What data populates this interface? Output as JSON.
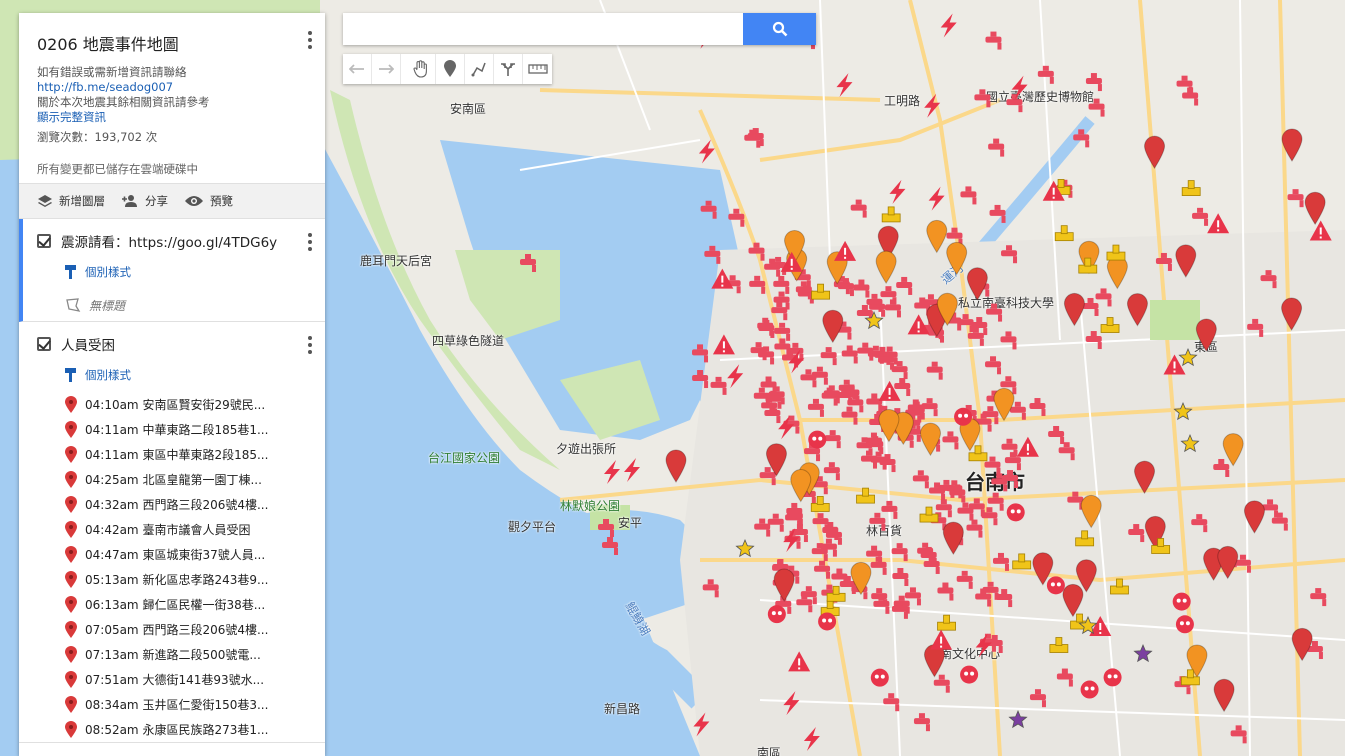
{
  "app": {
    "map_title": "0206 地震事件地圖",
    "desc_prefix": "如有錯誤或需新增資訊請聯絡",
    "desc_link": "http://fb.me/seadog007",
    "desc_line2": "關於本次地震其餘相關資訊請參考",
    "show_full": "顯示完整資訊",
    "views": "瀏覽次數：193,702 次",
    "saved": "所有變更都已儲存在雲端硬碟中"
  },
  "toolbar": {
    "add_layer": "新增圖層",
    "share": "分享",
    "preview": "預覽"
  },
  "layers": [
    {
      "title": "震源請看：https://goo.gl/4TDG6y",
      "style_label": "個別樣式",
      "untitled": "無標題"
    },
    {
      "title": "人員受困",
      "style_label": "個別樣式",
      "items": [
        "04:10am 安南區賢安街29號民...",
        "04:11am 中華東路二段185巷1...",
        "04:11am 東區中華東路2段185...",
        "04:25am 北區皇龍第一園丁棟...",
        "04:32am 西門路三段206號4樓...",
        "04:42am 臺南市議會人員受困",
        "04:47am 東區城東街37號人員...",
        "05:13am 新化區忠孝路243巷9...",
        "06:13am 歸仁區民權一街38巷...",
        "07:05am 西門路三段206號4樓...",
        "07:13am 新進路二段500號電...",
        "07:51am 大德街141巷93號水...",
        "08:34am 玉井區仁愛街150巷3...",
        "08:52am 永康區民族路273巷1..."
      ]
    }
  ],
  "search": {
    "placeholder": ""
  },
  "map_labels": {
    "annan": "安南區",
    "luermen": "鹿耳門天后宮",
    "sicao": "四草綠色隧道",
    "taijiang": "台江國家公園",
    "xiyou": "夕遊出張所",
    "lin_mo": "林默娘公園",
    "guanxi": "觀夕平台",
    "anping": "安平",
    "tainan": "台南市",
    "museum": "國立臺灣歷史博物館",
    "univ": "私立南臺科技大學",
    "culture": "臺南文化中心",
    "lin_bh": "林百貨",
    "south": "南區",
    "east": "東區",
    "canal": "運河",
    "lake": "鯤鯓湖",
    "gongming": "工明路",
    "xinchang": "新昌路"
  },
  "colors": {
    "accent": "#4285f4",
    "marker_red": "#d93a3a",
    "marker_orange": "#f29322",
    "marker_yellow": "#f0c419",
    "water": "#9fc7f0",
    "park": "#c5e3a5",
    "land": "#ecebe6"
  }
}
